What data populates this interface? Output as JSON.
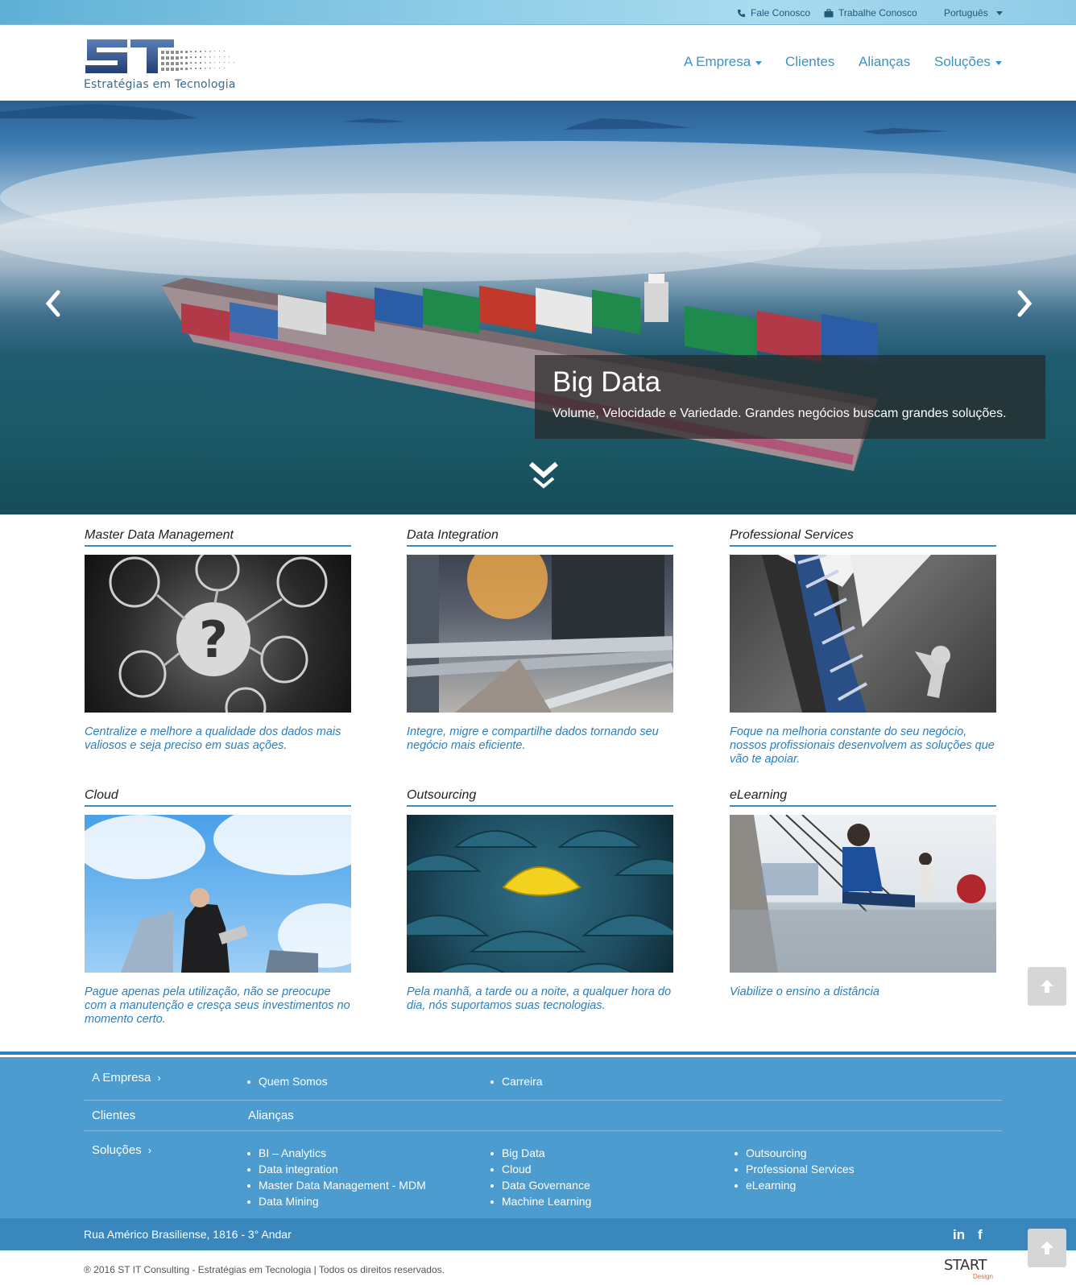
{
  "topbar": {
    "contact_label": "Fale Conosco",
    "work_label": "Trabalhe Conosco",
    "language_label": "Português"
  },
  "header": {
    "logo_tagline": "Estratégias em Tecnologia",
    "nav": [
      {
        "label": "A Empresa",
        "dropdown": true
      },
      {
        "label": "Clientes",
        "dropdown": false
      },
      {
        "label": "Alianças",
        "dropdown": false
      },
      {
        "label": "Soluções",
        "dropdown": true
      }
    ]
  },
  "hero": {
    "title": "Big Data",
    "subtitle": "Volume, Velocidade e Variedade. Grandes negócios buscam grandes soluções."
  },
  "cards": [
    {
      "title": "Master Data Management",
      "text": "Centralize e melhore a qualidade dos dados mais valiosos e seja preciso em suas ações."
    },
    {
      "title": "Data Integration",
      "text": "Integre, migre e compartilhe dados tornando seu negócio mais eficiente."
    },
    {
      "title": "Professional Services",
      "text": "Foque na melhoria constante do seu negócio, nossos profissionais desenvolvem as soluções que vão te apoiar."
    },
    {
      "title": "Cloud",
      "text": "Pague apenas pela utilização, não se preocupe com a manutenção e cresça seus investimentos no momento certo."
    },
    {
      "title": "Outsourcing",
      "text": "Pela manhã, a tarde ou a noite, a qualquer hora do dia, nós suportamos suas tecnologias."
    },
    {
      "title": "eLearning",
      "text": "Viabilize o ensino a distância"
    }
  ],
  "footer": {
    "empresa_label": "A Empresa",
    "empresa_links": [
      "Quem Somos",
      "Carreira"
    ],
    "clientes_label": "Clientes",
    "aliancas_label": "Alianças",
    "solucoes_label": "Soluções",
    "solucoes_col1": [
      "BI – Analytics",
      "Data integration",
      "Master Data Management - MDM",
      "Data Mining"
    ],
    "solucoes_col2": [
      "Big Data",
      "Cloud",
      "Data Governance",
      "Machine Learning"
    ],
    "solucoes_col3": [
      "Outsourcing",
      "Professional Services",
      "eLearning"
    ],
    "address": "Rua Américo Brasiliense, 1816 - 3° Andar",
    "social": {
      "linkedin": "in",
      "facebook": "f"
    },
    "copyright": "® 2016 ST IT Consulting - Estratégias em Tecnologia | Todos os direitos reservados.",
    "designer_logo": "START",
    "designer_sub": "Design"
  },
  "colors": {
    "accent": "#3a8bc6",
    "footer": "#4d9ccf",
    "footer_bar": "#3a87be"
  }
}
